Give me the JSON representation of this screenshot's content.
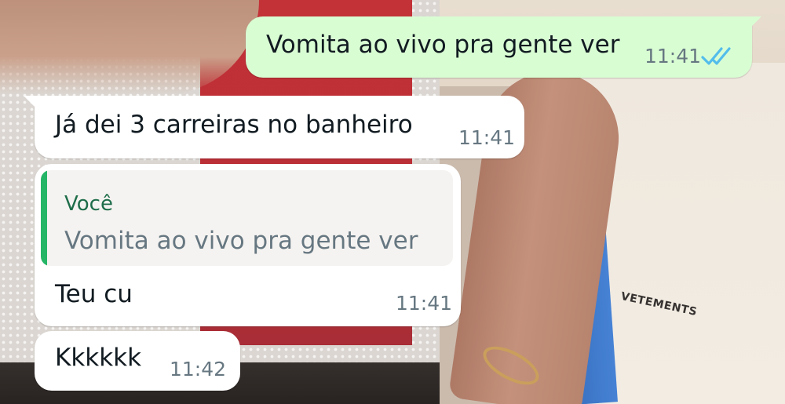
{
  "conversation": {
    "messages": [
      {
        "direction": "outgoing",
        "text": "Vomita ao vivo pra gente ver",
        "time": "11:41",
        "status": "read",
        "status_icon": "double-check-icon"
      },
      {
        "direction": "incoming",
        "text": "Já dei 3 carreiras no banheiro",
        "time": "11:41"
      },
      {
        "direction": "incoming",
        "quoted": {
          "author": "Você",
          "text": "Vomita ao vivo pra gente ver"
        },
        "text": "Teu cu",
        "time": "11:41"
      },
      {
        "direction": "incoming",
        "text": "Kkkkkk",
        "time": "11:42"
      }
    ]
  },
  "wallpaper": {
    "printed_text": "VETEMENTS"
  },
  "colors": {
    "outgoing_bubble": "#d9fdd3",
    "incoming_bubble": "#ffffff",
    "quote_bar": "#25b566",
    "quote_author": "#1e6d4a",
    "read_ticks": "#53bdeb",
    "timestamp": "#667781"
  }
}
